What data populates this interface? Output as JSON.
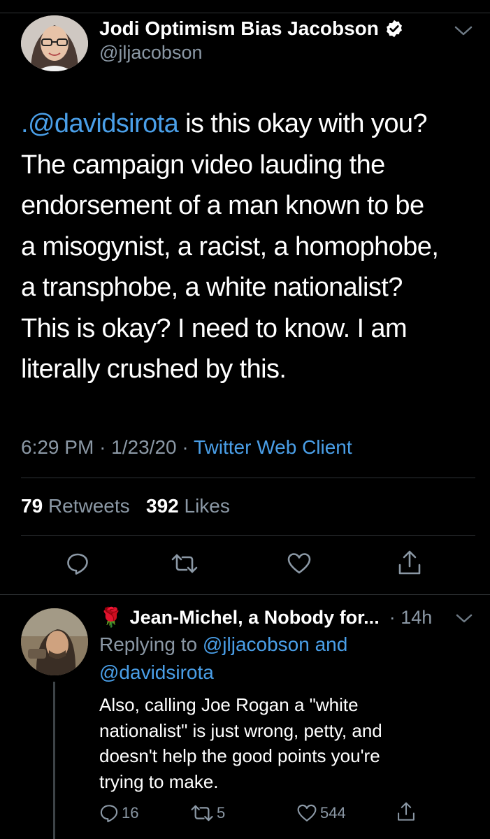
{
  "tweet": {
    "author_name": "Jodi Optimism Bias Jacobson",
    "handle": "@jljacobson",
    "body_mention": ".@davidsirota",
    "body_lines": [
      " is this okay with you?",
      "The campaign video lauding the",
      "endorsement of a man known to be",
      "a misogynist, a racist, a homophobe,",
      "a transphobe, a white nationalist?",
      "This is okay? I need to know. I am",
      "literally crushed by this."
    ],
    "time": "6:29 PM",
    "date": "1/23/20",
    "separator": "·",
    "client": "Twitter Web Client",
    "retweets_count": "79",
    "retweets_label": "Retweets",
    "likes_count": "392",
    "likes_label": "Likes",
    "icons": [
      "reply-icon",
      "retweet-icon",
      "like-icon",
      "share-icon",
      "verified-badge-icon",
      "chevron-down-icon"
    ]
  },
  "reply": {
    "emoji": "🌹",
    "author_name": "Jean-Michel, a Nobody for...",
    "time": "· 14h",
    "replying_prefix": "Replying to",
    "replying_handle_1": "@jljacobson",
    "replying_and": "and",
    "replying_handle_2": "@davidsirota",
    "text_lines": [
      "Also, calling Joe Rogan a \"white",
      "nationalist\" is just wrong, petty, and",
      "doesn't help the good points you're",
      "trying to make."
    ],
    "reply_count": "16",
    "retweet_count": "5",
    "like_count": "544"
  },
  "colors": {
    "background": "#000000",
    "text": "#ffffff",
    "muted": "#8b98a5",
    "link": "#4a9fe8",
    "divider": "#2f3336",
    "rose": "#d9212b"
  }
}
